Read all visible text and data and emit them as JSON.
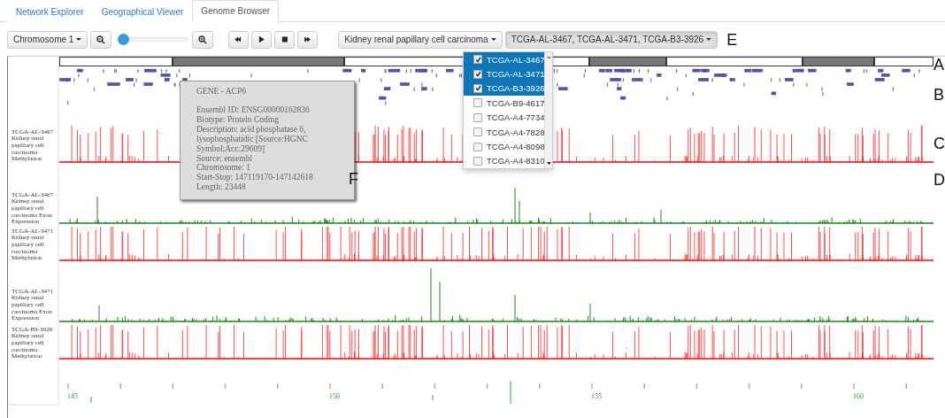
{
  "tabs": [
    {
      "label": "Network Explorer",
      "selected": false
    },
    {
      "label": "Geographical Viewer",
      "selected": false
    },
    {
      "label": "Genome Browser",
      "selected": true
    }
  ],
  "toolbar": {
    "chromosome": "Chromosome 1",
    "zoom": {
      "level": 0
    },
    "cancer": "Kidney renal papillary cell carcinoma",
    "samples": "TCGA-AL-3467, TCGA-AL-3471, TCGA-B3-3926",
    "marker": "E"
  },
  "sample_menu": [
    {
      "label": "TCGA-AL-3467",
      "checked": true,
      "selected": true
    },
    {
      "label": "TCGA-AL-3471",
      "checked": true,
      "selected": true
    },
    {
      "label": "TCGA-B3-3926",
      "checked": true,
      "selected": true
    },
    {
      "label": "TCGA-B9-4617",
      "checked": false,
      "selected": false
    },
    {
      "label": "TCGA-A4-7734",
      "checked": false,
      "selected": false
    },
    {
      "label": "TCGA-A4-7828",
      "checked": false,
      "selected": false
    },
    {
      "label": "TCGA-A4-8098",
      "checked": false,
      "selected": false
    },
    {
      "label": "TCGA-A4-8310",
      "checked": false,
      "selected": false
    }
  ],
  "ideogram": {
    "marker": "A"
  },
  "genes": {
    "marker": "B"
  },
  "tracks": [
    {
      "label": "TCGA-AL-3467 Kidney renal papillary cell carcinoma Methylation",
      "kind": "methylation",
      "marker": "C"
    },
    {
      "label": "TCGA-AL-3467 Kidney renal papillary cell carcinoma Exon Expression",
      "kind": "expression",
      "marker": "D"
    },
    {
      "label": "TCGA-AL-3471 Kidney renal papillary cell carcinoma Methylation",
      "kind": "methylation"
    },
    {
      "label": "TCGA-AL-3471 Kidney renal papillary cell carcinoma Exon Expression",
      "kind": "expression"
    },
    {
      "label": "TCGA-B3-3926 Kidney renal papillary cell carcinoma Methylation",
      "kind": "methylation"
    }
  ],
  "axis": {
    "labels": [
      "145",
      "150",
      "155",
      "160"
    ]
  },
  "tooltip": {
    "title": "GENE - ACP6",
    "marker": "F",
    "lines": [
      "Ensembl ID: ENSG00000162836",
      "Biotype: Protein Coding",
      "Description: acid phosphatase 6, lysophosphatidic [Source:HGNC Symbol;Acc:29609]",
      "Source: ensembl",
      "Chromosome: 1",
      "Start-Stop: 147119170-147142618",
      "Length: 23448"
    ]
  }
}
